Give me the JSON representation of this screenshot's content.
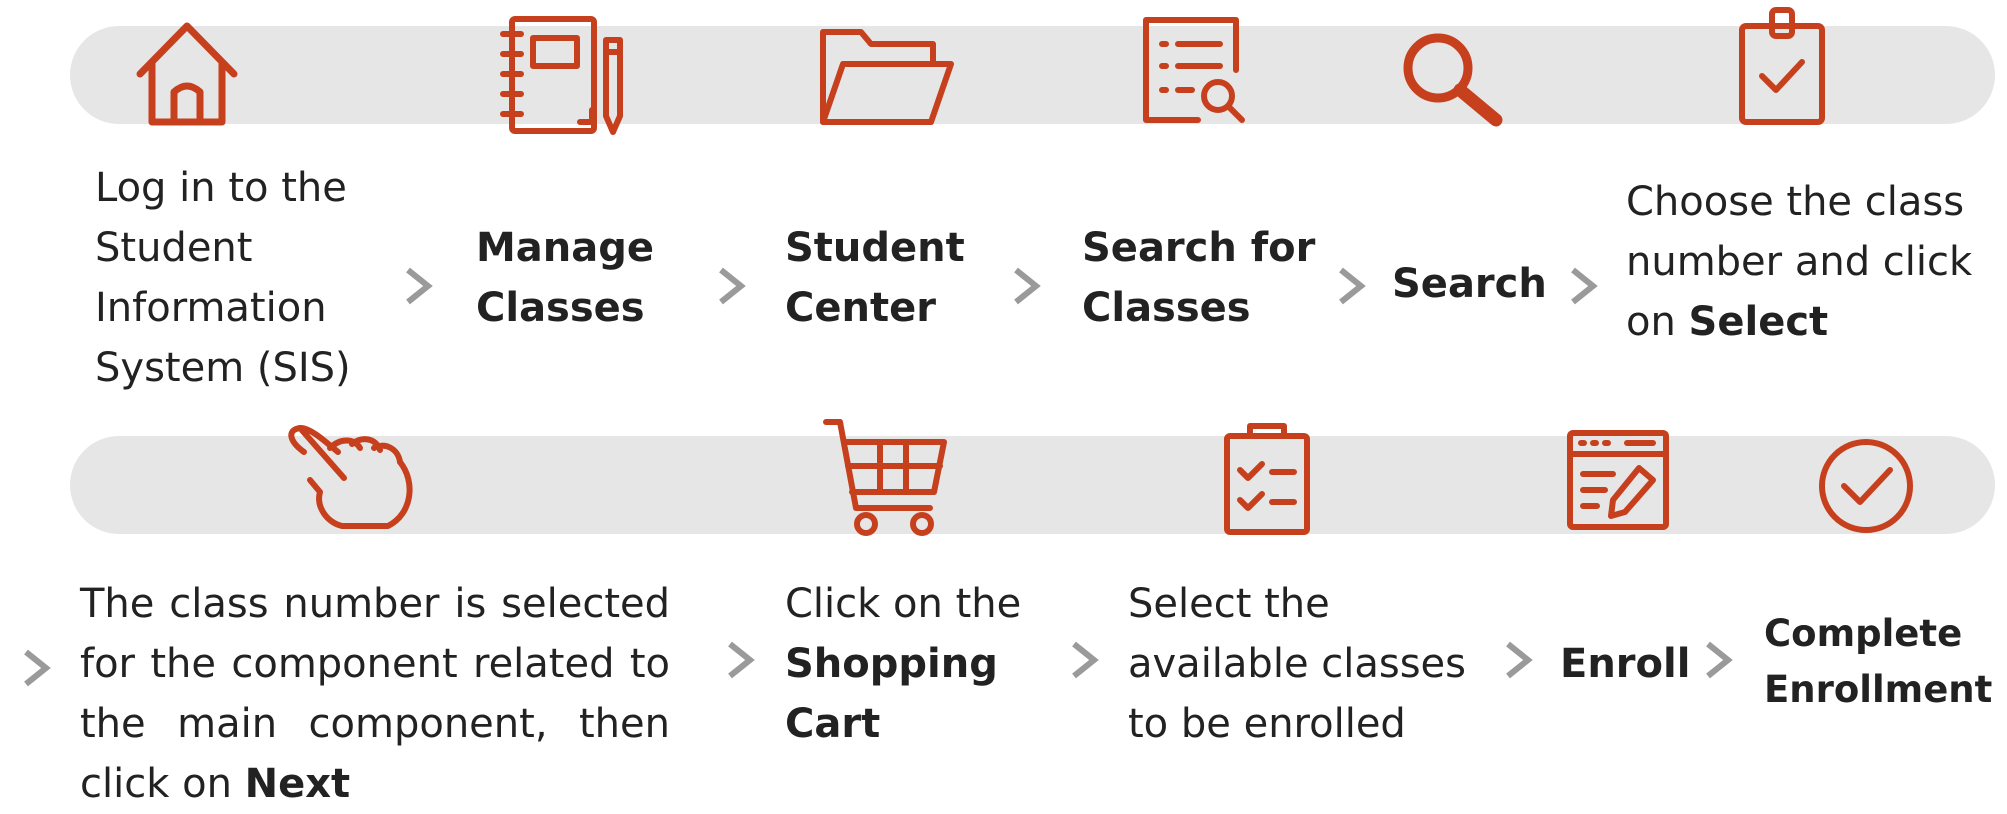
{
  "accent_color": "#c7401e",
  "arrow_color": "#9a9a9a",
  "band_color": "#e6e6e6",
  "rows": [
    {
      "steps": [
        {
          "icon": "home-icon",
          "text": "Log in to the Student Information System (SIS)"
        },
        {
          "icon": "notebook-icon",
          "text": "Manage Classes"
        },
        {
          "icon": "folder-icon",
          "text": "Student Center"
        },
        {
          "icon": "list-search-icon",
          "text": "Search for Classes"
        },
        {
          "icon": "search-icon",
          "text": "Search"
        },
        {
          "icon": "clipboard-check-icon",
          "text_before": "Choose the class number and click on",
          "text_bold": "Select"
        }
      ]
    },
    {
      "steps": [
        {
          "icon": "pointing-hand-icon",
          "text_before": "The class number is selected for the component related to the main component, then click on",
          "text_bold": "Next"
        },
        {
          "icon": "shopping-cart-icon",
          "text_before": "Click on the",
          "text_bold": "Shopping Cart"
        },
        {
          "icon": "checklist-icon",
          "text": "Select the available classes to be enrolled"
        },
        {
          "icon": "edit-window-icon",
          "text": "Enroll"
        },
        {
          "icon": "check-circle-icon",
          "text": "Complete Enrollment"
        }
      ]
    }
  ]
}
